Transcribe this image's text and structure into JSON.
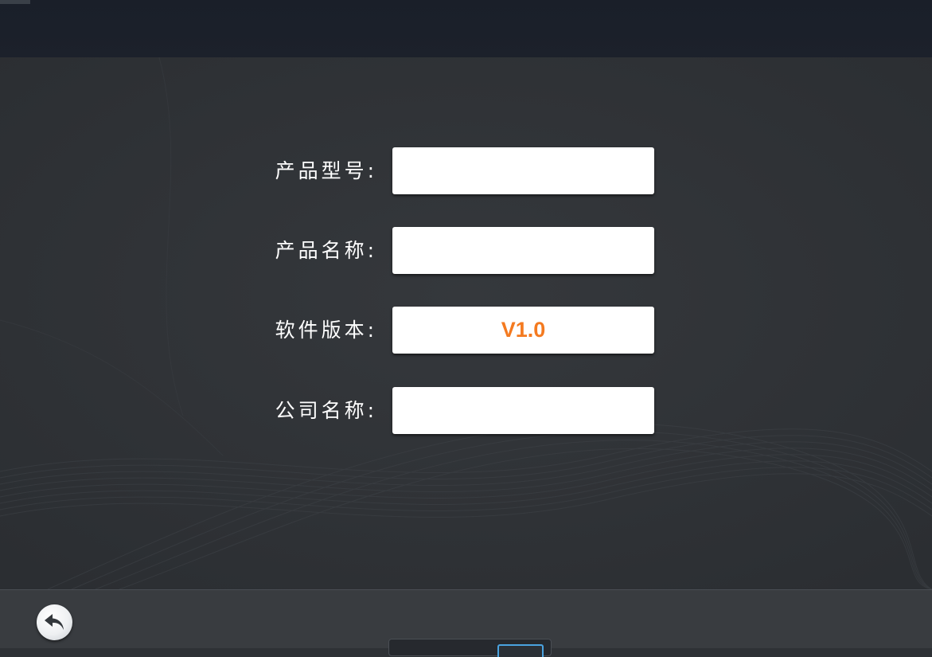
{
  "form": {
    "rows": [
      {
        "label": "产品型号:",
        "value": ""
      },
      {
        "label": "产品名称:",
        "value": ""
      },
      {
        "label": "软件版本:",
        "value": "V1.0"
      },
      {
        "label": "公司名称:",
        "value": ""
      }
    ]
  },
  "icons": {
    "back": "back-arrow-icon"
  },
  "colors": {
    "version_text": "#f47a20",
    "background": "#323539",
    "top_bar": "#1b202a",
    "bottom_bar": "#393c40"
  }
}
